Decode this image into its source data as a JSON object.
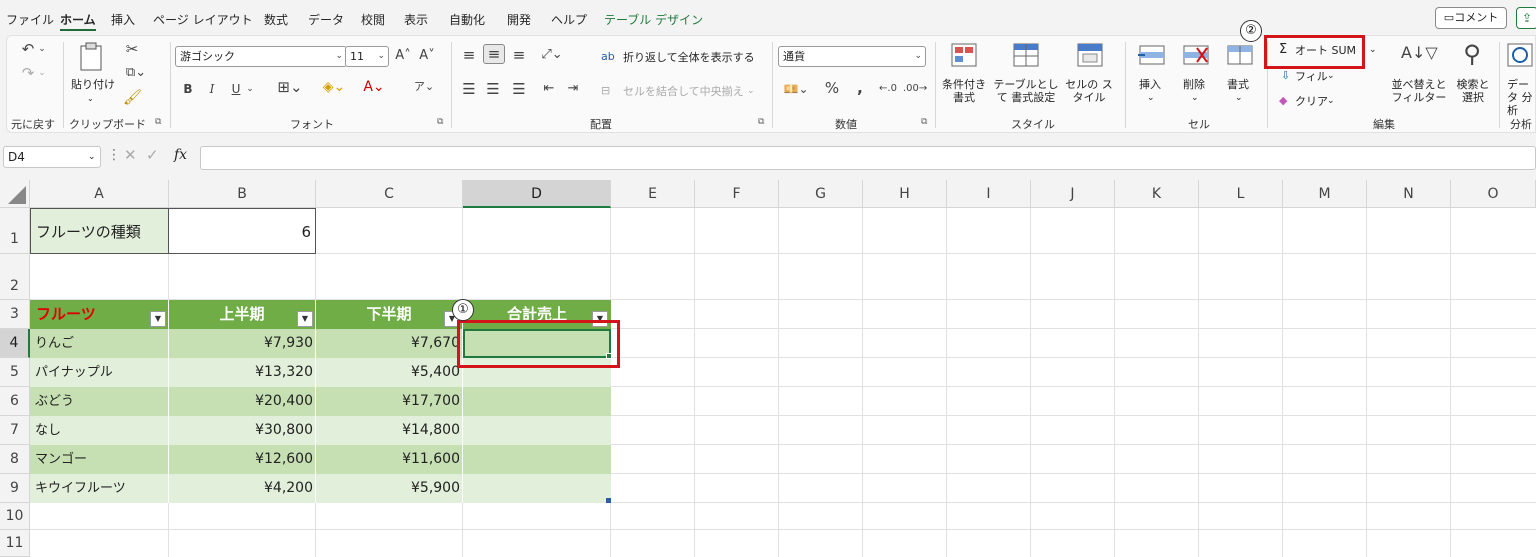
{
  "menu": {
    "tabs": [
      "ファイル",
      "ホーム",
      "挿入",
      "ページ レイアウト",
      "数式",
      "データ",
      "校閲",
      "表示",
      "自動化",
      "開発",
      "ヘルプ",
      "テーブル デザイン"
    ],
    "active_tab": "ホーム",
    "comment_button": "コメント"
  },
  "ribbon": {
    "undo_group": "元に戻す",
    "clipboard": {
      "label": "クリップボード",
      "paste": "貼り付け"
    },
    "font": {
      "label": "フォント",
      "name": "游ゴシック",
      "size": "11",
      "bold": "B",
      "italic": "I",
      "underline": "U"
    },
    "alignment": {
      "label": "配置",
      "wrap_text": "折り返して全体を表示する",
      "merge_center": "セルを結合して中央揃え"
    },
    "number": {
      "label": "数値",
      "format": "通貨"
    },
    "styles": {
      "label": "スタイル",
      "conditional": "条件付き 書式",
      "as_table": "テーブルとして 書式設定",
      "cell_styles": "セルの スタイル"
    },
    "cells": {
      "label": "セル",
      "insert": "挿入",
      "delete": "削除",
      "format": "書式"
    },
    "editing": {
      "label": "編集",
      "autosum": "オート SUM",
      "fill": "フィル",
      "clear": "クリア",
      "sort_filter": "並べ替えと フィルター",
      "find_select": "検索と 選択"
    },
    "analysis": {
      "label": "分析",
      "data_analysis": "データ 分析"
    }
  },
  "formula_bar": {
    "name_box": "D4",
    "fx": "fx",
    "value": ""
  },
  "columns": [
    "A",
    "B",
    "C",
    "D",
    "E",
    "F",
    "G",
    "H",
    "I",
    "J",
    "K",
    "L",
    "M",
    "N",
    "O"
  ],
  "rows": [
    "1",
    "2",
    "3",
    "4",
    "5",
    "6",
    "7",
    "8",
    "9",
    "10",
    "11"
  ],
  "sheet": {
    "a1": "フルーツの種類",
    "b1": "6",
    "table_headers": [
      "フルーツ",
      "上半期",
      "下半期",
      "合計売上"
    ],
    "table_rows": [
      {
        "fruit": "りんご",
        "h1": "¥7,930",
        "h2": "¥7,670",
        "total": ""
      },
      {
        "fruit": "パイナップル",
        "h1": "¥13,320",
        "h2": "¥5,400",
        "total": ""
      },
      {
        "fruit": "ぶどう",
        "h1": "¥20,400",
        "h2": "¥17,700",
        "total": ""
      },
      {
        "fruit": "なし",
        "h1": "¥30,800",
        "h2": "¥14,800",
        "total": ""
      },
      {
        "fruit": "マンゴー",
        "h1": "¥12,600",
        "h2": "¥11,600",
        "total": ""
      },
      {
        "fruit": "キウイフルーツ",
        "h1": "¥4,200",
        "h2": "¥5,900",
        "total": ""
      }
    ]
  },
  "annotations": {
    "step1": "①",
    "step2": "②"
  },
  "colors": {
    "table_header": "#70ad47",
    "band_dark": "#c6e0b4",
    "band_light": "#e2efda",
    "highlight": "#d3151a",
    "accent": "#1f7a3d"
  }
}
